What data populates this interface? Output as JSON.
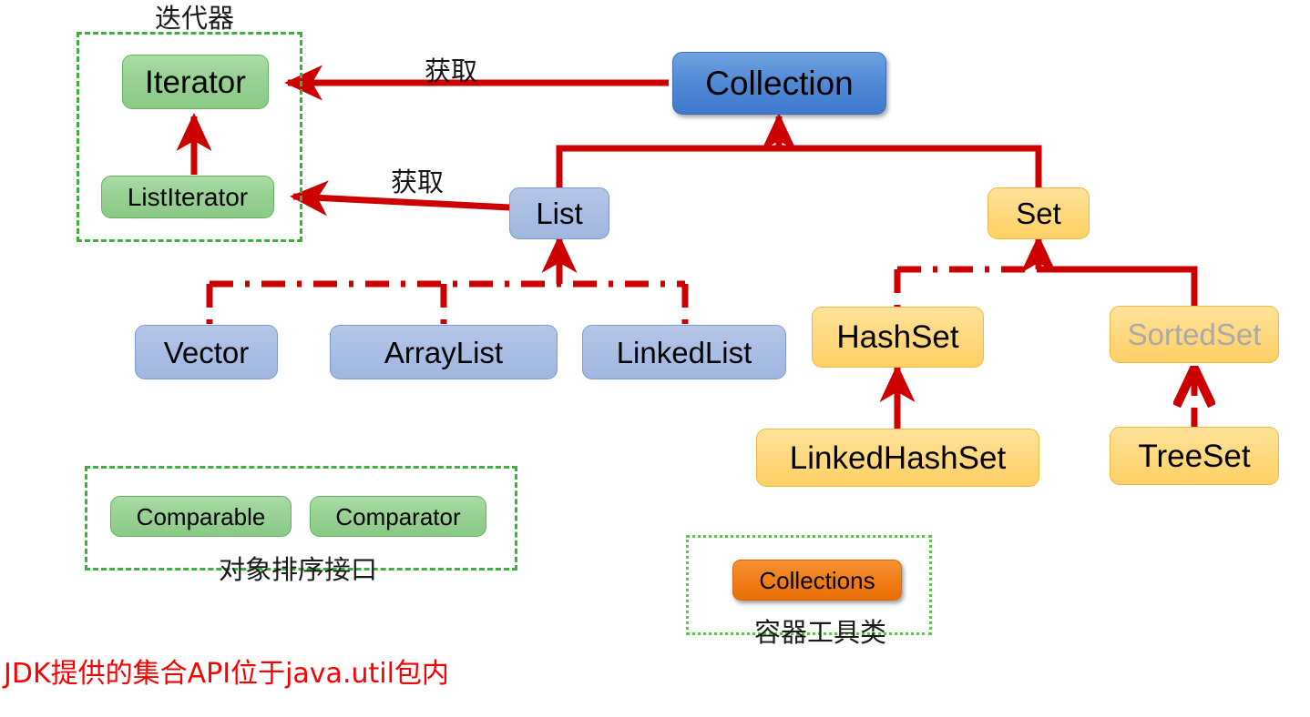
{
  "diagram": {
    "title_note": "JDK提供的集合API位于java.util包内",
    "accent_colors": {
      "connector_red": "#cc0000",
      "group_border_green": "#3faf3f",
      "group_border_green_dotted": "#5cc64a",
      "note_red": "#fb0000",
      "green_node": "#97d193",
      "blue_dark_node": "#4f86d4",
      "blue_light_node": "#a8bde3",
      "yellow_node": "#ffd87c",
      "orange_node": "#f07c16",
      "muted_text": "#a9a9a9"
    }
  },
  "groups": [
    {
      "id": "iterator-group",
      "caption": "迭代器"
    },
    {
      "id": "sorting-group",
      "caption": "对象排序接口"
    },
    {
      "id": "utility-group",
      "caption": "容器工具类"
    }
  ],
  "nodes": {
    "iterator": {
      "label": "Iterator",
      "kind": "interface",
      "color": "green"
    },
    "list_iterator": {
      "label": "ListIterator",
      "kind": "interface",
      "color": "green"
    },
    "collection": {
      "label": "Collection",
      "kind": "interface",
      "color": "blue-dark"
    },
    "list": {
      "label": "List",
      "kind": "interface",
      "color": "blue-light"
    },
    "set": {
      "label": "Set",
      "kind": "interface",
      "color": "yellow"
    },
    "vector": {
      "label": "Vector",
      "kind": "class",
      "color": "blue-light"
    },
    "arraylist": {
      "label": "ArrayList",
      "kind": "class",
      "color": "blue-light"
    },
    "linkedlist": {
      "label": "LinkedList",
      "kind": "class",
      "color": "blue-light"
    },
    "hashset": {
      "label": "HashSet",
      "kind": "class",
      "color": "yellow"
    },
    "sortedset": {
      "label": "SortedSet",
      "kind": "interface",
      "color": "yellow"
    },
    "linkedhashset": {
      "label": "LinkedHashSet",
      "kind": "class",
      "color": "yellow"
    },
    "treeset": {
      "label": "TreeSet",
      "kind": "class",
      "color": "yellow"
    },
    "comparable": {
      "label": "Comparable",
      "kind": "interface",
      "color": "green"
    },
    "comparator": {
      "label": "Comparator",
      "kind": "interface",
      "color": "green"
    },
    "collections": {
      "label": "Collections",
      "kind": "utility-class",
      "color": "orange"
    }
  },
  "edge_labels": {
    "collection_to_iterator": "获取",
    "list_to_listiterator": "获取"
  }
}
